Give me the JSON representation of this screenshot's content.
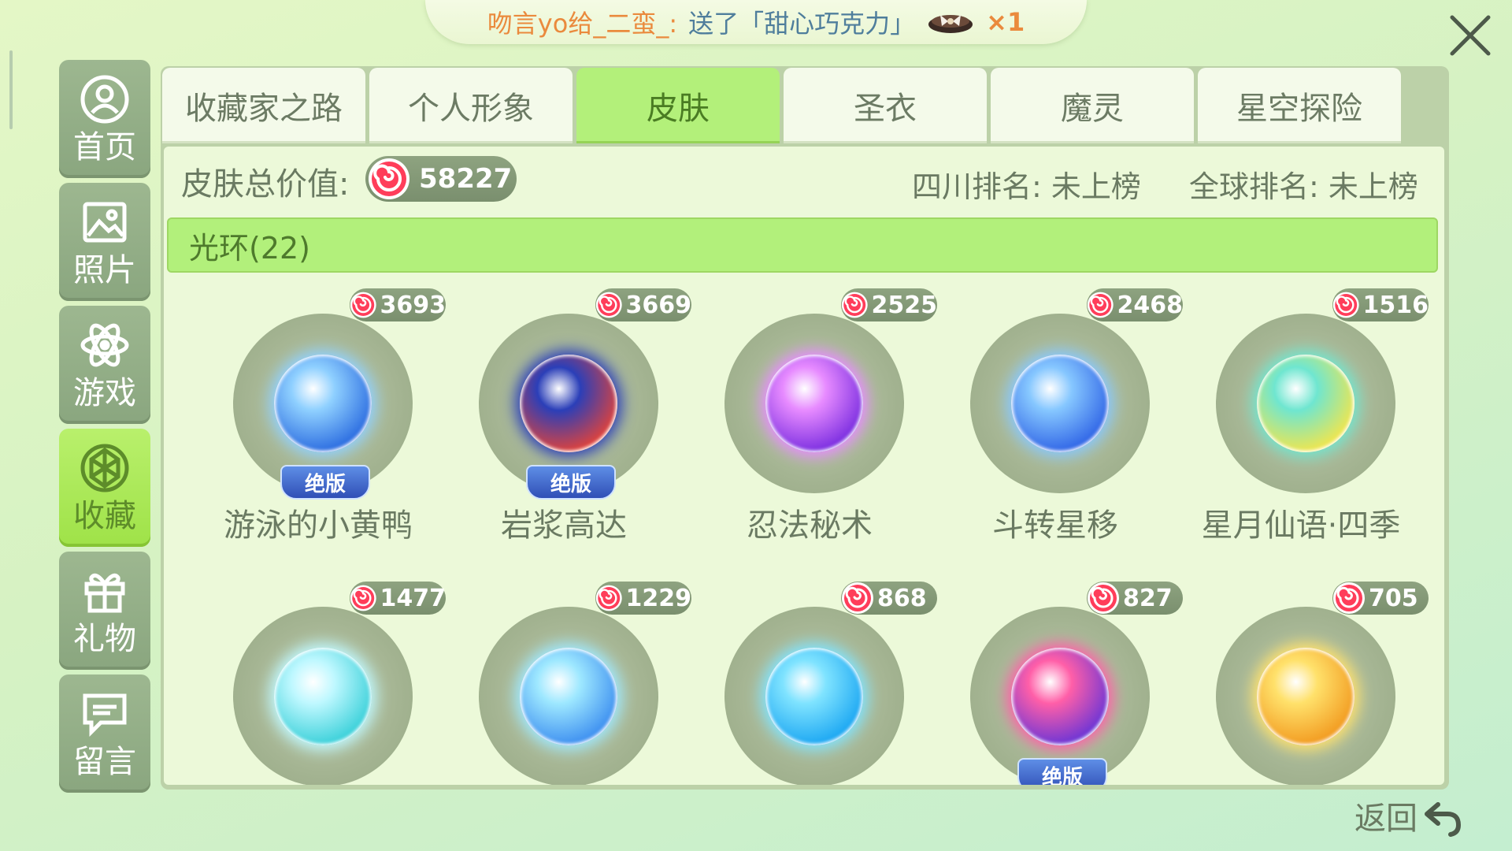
{
  "banner": {
    "sender": "吻言yo给_二蛮_:",
    "action": "送了「甜心巧克力」",
    "gift_icon": "chocolate-gift-icon",
    "count": "×1"
  },
  "sidebar": {
    "items": [
      {
        "label": "首页",
        "icon": "home-user-icon",
        "active": false
      },
      {
        "label": "照片",
        "icon": "photo-icon",
        "active": false
      },
      {
        "label": "游戏",
        "icon": "atom-game-icon",
        "active": false
      },
      {
        "label": "收藏",
        "icon": "collection-icon",
        "active": true
      },
      {
        "label": "礼物",
        "icon": "gift-icon",
        "active": false
      },
      {
        "label": "留言",
        "icon": "message-icon",
        "active": false
      }
    ]
  },
  "tabs": [
    {
      "label": "收藏家之路",
      "active": false
    },
    {
      "label": "个人形象",
      "active": false
    },
    {
      "label": "皮肤",
      "active": true
    },
    {
      "label": "圣衣",
      "active": false
    },
    {
      "label": "魔灵",
      "active": false
    },
    {
      "label": "星空探险",
      "active": false
    }
  ],
  "summary": {
    "total_label": "皮肤总价值:",
    "total_value": "58227",
    "province_rank": "四川排名: 未上榜",
    "global_rank": "全球排名: 未上榜"
  },
  "section": {
    "title": "光环(22)"
  },
  "items": [
    {
      "name": "游泳的小黄鸭",
      "price": "3693",
      "badge": "绝版",
      "colors": [
        "#8fd0ff",
        "#2a6be0"
      ]
    },
    {
      "name": "岩浆高达",
      "price": "3669",
      "badge": "绝版",
      "colors": [
        "#2b3fb8",
        "#e2433a"
      ]
    },
    {
      "name": "忍法秘术",
      "price": "2525",
      "badge": "",
      "colors": [
        "#e78bff",
        "#7a2de0"
      ]
    },
    {
      "name": "斗转星移",
      "price": "2468",
      "badge": "",
      "colors": [
        "#86c7ff",
        "#2f64e6"
      ]
    },
    {
      "name": "星月仙语·四季",
      "price": "1516",
      "badge": "",
      "colors": [
        "#6fe6d0",
        "#f2e64c"
      ]
    },
    {
      "name": "",
      "price": "1477",
      "badge": "",
      "colors": [
        "#bff8ff",
        "#39d0d9"
      ]
    },
    {
      "name": "",
      "price": "1229",
      "badge": "",
      "colors": [
        "#9ee8ff",
        "#3c8ef0"
      ]
    },
    {
      "name": "",
      "price": "868",
      "badge": "",
      "colors": [
        "#7fe3ff",
        "#1aa6f2"
      ]
    },
    {
      "name": "",
      "price": "827",
      "badge": "绝版",
      "colors": [
        "#ff5fa8",
        "#6a34d6"
      ]
    },
    {
      "name": "",
      "price": "705",
      "badge": "",
      "colors": [
        "#ffe16b",
        "#f29a1f"
      ]
    }
  ],
  "footer": {
    "back_label": "返回"
  },
  "colors": {
    "accent_green": "#b2f07b",
    "price_pill": "#7a8f6e",
    "coin_red": "#ff3d5a"
  }
}
